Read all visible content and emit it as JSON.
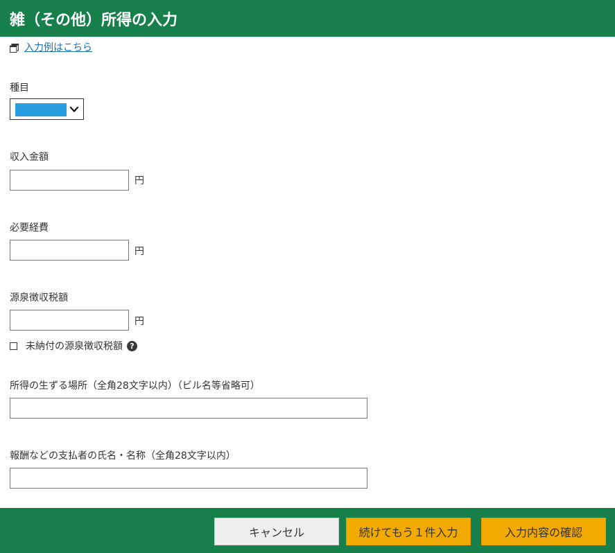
{
  "header": {
    "title": "雑（その他）所得の入力"
  },
  "example_link": {
    "label": "入力例はこちら"
  },
  "fields": {
    "type": {
      "label": "種目",
      "selected_value": ""
    },
    "income_amount": {
      "label": "収入金額",
      "value": "",
      "unit": "円"
    },
    "necessary_expenses": {
      "label": "必要経費",
      "value": "",
      "unit": "円"
    },
    "withholding_tax": {
      "label": "源泉徴収税額",
      "value": "",
      "unit": "円"
    },
    "unpaid_withholding": {
      "label": "未納付の源泉徴収税額",
      "checked": false,
      "help_glyph": "?"
    },
    "income_location": {
      "label": "所得の生ずる場所（全角28文字以内）（ビル名等省略可）",
      "value": ""
    },
    "payer_name": {
      "label": "報酬などの支払者の氏名・名称（全角28文字以内）",
      "value": ""
    }
  },
  "footer": {
    "cancel_label": "キャンセル",
    "continue_label": "続けてもう１件入力",
    "confirm_label": "入力内容の確認"
  },
  "colors": {
    "header_bg": "#17804a",
    "link": "#1a6fb3",
    "select_highlight": "#2a9fe0",
    "primary_button": "#f2a900",
    "secondary_button": "#efefef"
  },
  "icons": {
    "example_link": "window-icon",
    "select": "chevron-down-icon",
    "help": "help-icon"
  }
}
